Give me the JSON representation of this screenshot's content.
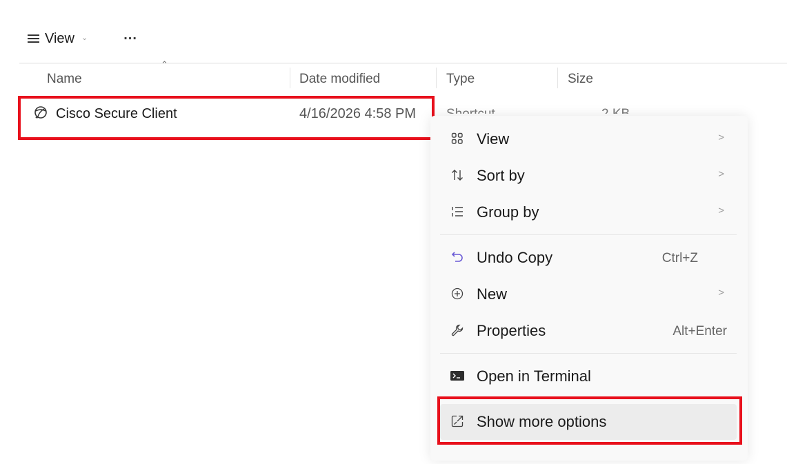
{
  "toolbar": {
    "view_label": "View",
    "more_label": "..."
  },
  "columns": {
    "name": "Name",
    "date_modified": "Date modified",
    "type": "Type",
    "size": "Size"
  },
  "files": [
    {
      "name": "Cisco Secure Client",
      "date_modified": "4/16/2026 4:58 PM",
      "type": "Shortcut",
      "size": "2 KB",
      "icon": "cisco-globe-icon"
    }
  ],
  "context_menu": {
    "items": [
      {
        "label": "View",
        "icon": "grid-view-icon",
        "submenu": true
      },
      {
        "label": "Sort by",
        "icon": "sort-arrows-icon",
        "submenu": true
      },
      {
        "label": "Group by",
        "icon": "group-list-icon",
        "submenu": true
      },
      {
        "label": "Undo Copy",
        "icon": "undo-icon",
        "shortcut": "Ctrl+Z"
      },
      {
        "label": "New",
        "icon": "plus-circle-icon",
        "submenu": true
      },
      {
        "label": "Properties",
        "icon": "wrench-icon",
        "shortcut": "Alt+Enter"
      },
      {
        "label": "Open in Terminal",
        "icon": "terminal-icon"
      },
      {
        "label": "Show more options",
        "icon": "show-more-icon",
        "hovered": true
      }
    ],
    "submenu_glyph": ">"
  },
  "colors": {
    "highlight": "#e8101c",
    "menu_bg": "#f9f9f9"
  }
}
